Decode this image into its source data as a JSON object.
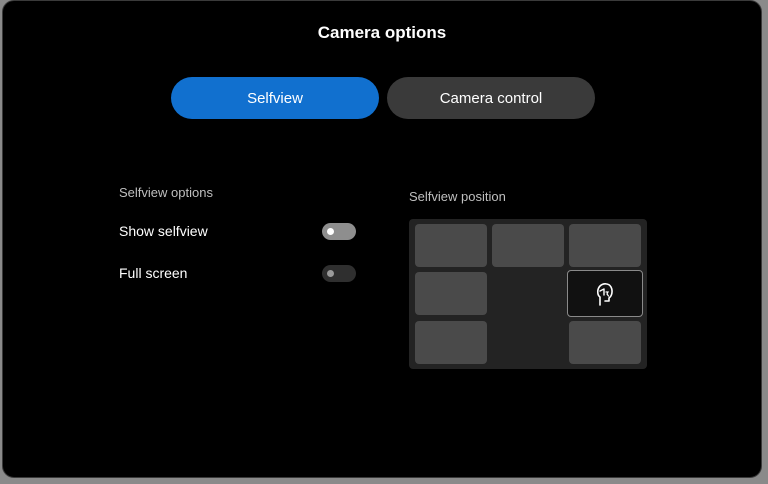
{
  "dialog": {
    "title": "Camera options"
  },
  "tabs": [
    {
      "label": "Selfview",
      "selected": true
    },
    {
      "label": "Camera control",
      "selected": false
    }
  ],
  "selfview_options": {
    "heading": "Selfview options",
    "show_selfview": {
      "label": "Show selfview",
      "on": true
    },
    "full_screen": {
      "label": "Full screen",
      "on": false
    }
  },
  "selfview_position": {
    "heading": "Selfview position",
    "selected_position": "middle-right",
    "icon": "selfview-person-icon"
  },
  "colors": {
    "accent": "#1170cf",
    "tab_inactive": "#3a3a3a",
    "background": "#000000"
  }
}
